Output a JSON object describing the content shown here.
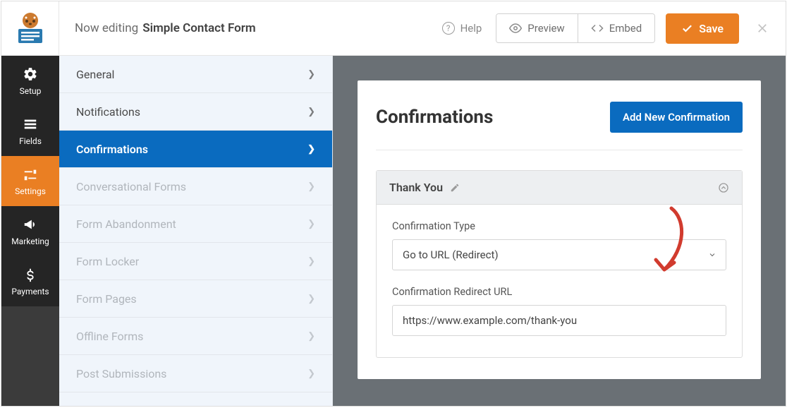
{
  "header": {
    "now_editing_prefix": "Now editing",
    "form_title": "Simple Contact Form",
    "help_label": "Help",
    "preview_label": "Preview",
    "embed_label": "Embed",
    "save_label": "Save"
  },
  "nav": {
    "items": [
      {
        "label": "Setup"
      },
      {
        "label": "Fields"
      },
      {
        "label": "Settings"
      },
      {
        "label": "Marketing"
      },
      {
        "label": "Payments"
      }
    ]
  },
  "sidebar": {
    "items": [
      {
        "label": "General",
        "enabled": true
      },
      {
        "label": "Notifications",
        "enabled": true
      },
      {
        "label": "Confirmations",
        "enabled": true,
        "active": true
      },
      {
        "label": "Conversational Forms",
        "enabled": false
      },
      {
        "label": "Form Abandonment",
        "enabled": false
      },
      {
        "label": "Form Locker",
        "enabled": false
      },
      {
        "label": "Form Pages",
        "enabled": false
      },
      {
        "label": "Offline Forms",
        "enabled": false
      },
      {
        "label": "Post Submissions",
        "enabled": false
      }
    ]
  },
  "main": {
    "title": "Confirmations",
    "add_button": "Add New Confirmation",
    "confirmation": {
      "name": "Thank You",
      "type_label": "Confirmation Type",
      "type_value": "Go to URL (Redirect)",
      "redirect_label": "Confirmation Redirect URL",
      "redirect_value": "https://www.example.com/thank-you"
    }
  }
}
